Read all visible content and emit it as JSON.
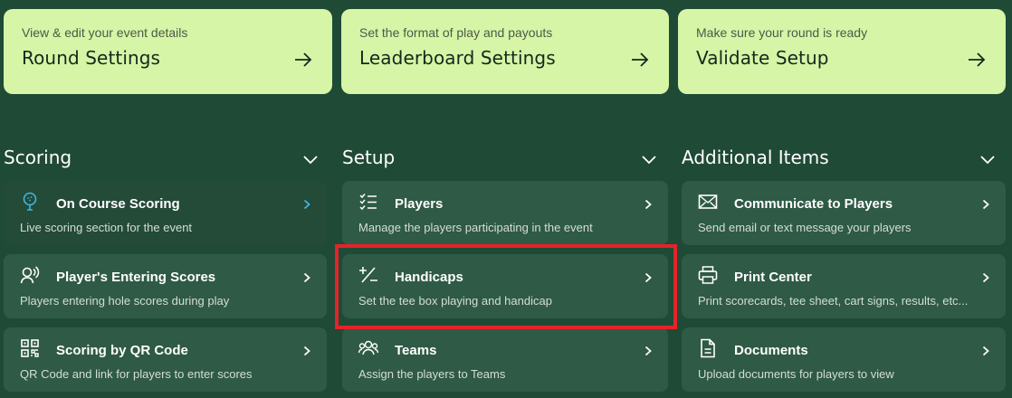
{
  "top_cards": [
    {
      "subtitle": "View & edit your event details",
      "title": "Round Settings"
    },
    {
      "subtitle": "Set the format of play and payouts",
      "title": "Leaderboard Settings"
    },
    {
      "subtitle": "Make sure your round is ready",
      "title": "Validate Setup"
    }
  ],
  "sections": {
    "scoring": {
      "title": "Scoring",
      "items": [
        {
          "title": "On Course Scoring",
          "desc": "Live scoring section for the event",
          "icon": "golf-ball-icon"
        },
        {
          "title": "Player's Entering Scores",
          "desc": "Players entering hole scores during play",
          "icon": "user-voice-icon"
        },
        {
          "title": "Scoring by QR Code",
          "desc": "QR Code and link for players to enter scores",
          "icon": "qr-code-icon"
        }
      ]
    },
    "setup": {
      "title": "Setup",
      "items": [
        {
          "title": "Players",
          "desc": "Manage the players participating in the event",
          "icon": "checklist-icon"
        },
        {
          "title": "Handicaps",
          "desc": "Set the tee box playing and handicap",
          "icon": "plus-minus-icon"
        },
        {
          "title": "Teams",
          "desc": "Assign the players to Teams",
          "icon": "team-icon"
        }
      ]
    },
    "additional": {
      "title": "Additional Items",
      "items": [
        {
          "title": "Communicate to Players",
          "desc": "Send email or text message your players",
          "icon": "envelope-icon"
        },
        {
          "title": "Print Center",
          "desc": "Print scorecards, tee sheet, cart signs, results, etc...",
          "icon": "printer-icon"
        },
        {
          "title": "Documents",
          "desc": "Upload documents for players to view",
          "icon": "document-icon"
        }
      ]
    }
  },
  "colors": {
    "background": "#1f4a36",
    "card_light": "#d6f5a6",
    "item_bg": "#2f5a45",
    "item_active_bg": "#244a38",
    "active_chevron": "#3fb6e0",
    "highlight": "#e5232a"
  }
}
